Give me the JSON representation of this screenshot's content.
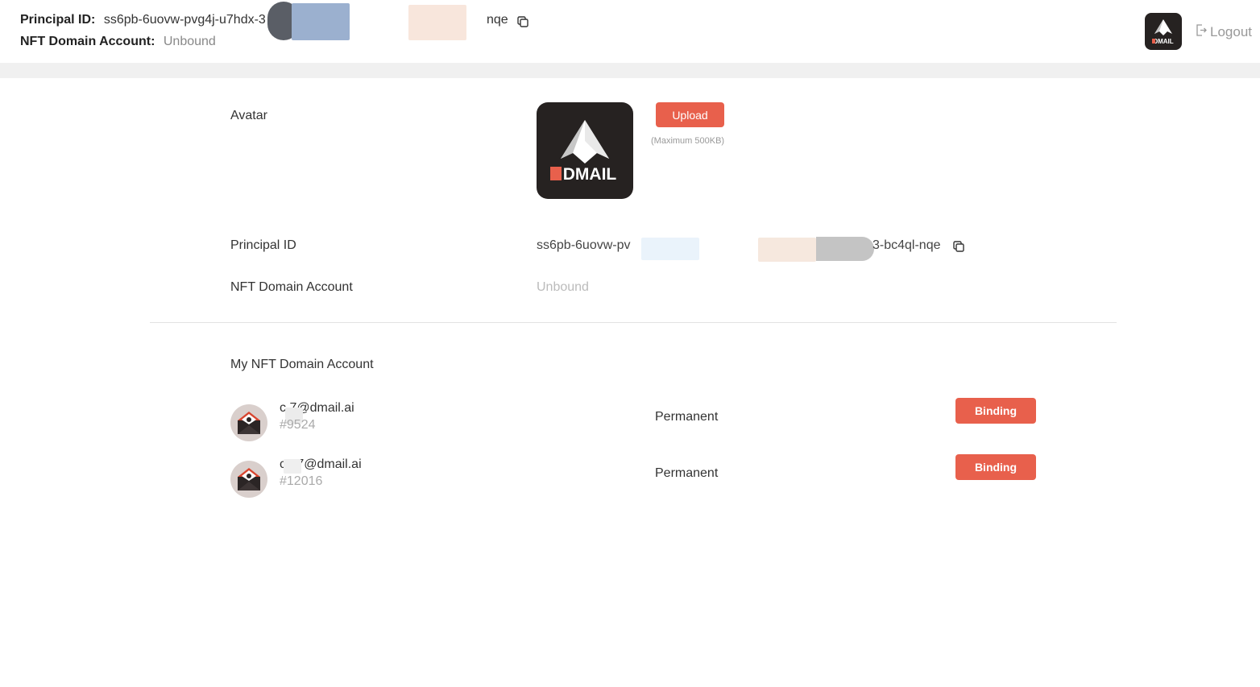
{
  "header": {
    "principal_label": "Principal ID:",
    "principal_value_start": "ss6pb-6uovw-pvg4j-u7hdx-3",
    "principal_value_end": "nqe",
    "nft_label": "NFT Domain Account:",
    "nft_value": "Unbound",
    "logout_label": "Logout",
    "logo_text": "DMAIL"
  },
  "profile": {
    "avatar_label": "Avatar",
    "avatar_logo_text": "DMAIL",
    "upload_label": "Upload",
    "upload_hint": "(Maximum 500KB)",
    "principal_label": "Principal ID",
    "principal_value_start": "ss6pb-6uovw-pv",
    "principal_value_end": "3-bc4ql-nqe",
    "nft_label": "NFT Domain Account",
    "nft_value": "Unbound"
  },
  "nft_section": {
    "title": "My NFT Domain Account",
    "accounts": [
      {
        "email": "c          7@dmail.ai",
        "number": "#9524",
        "term": "Permanent",
        "action": "Binding"
      },
      {
        "email": "c      27@dmail.ai",
        "number": "#12016",
        "term": "Permanent",
        "action": "Binding"
      }
    ]
  },
  "colors": {
    "accent": "#e8604c",
    "logo_bg": "#262221"
  },
  "icons": [
    "copy-icon",
    "logout-icon",
    "dmail-logo-icon",
    "envelope-icon"
  ]
}
